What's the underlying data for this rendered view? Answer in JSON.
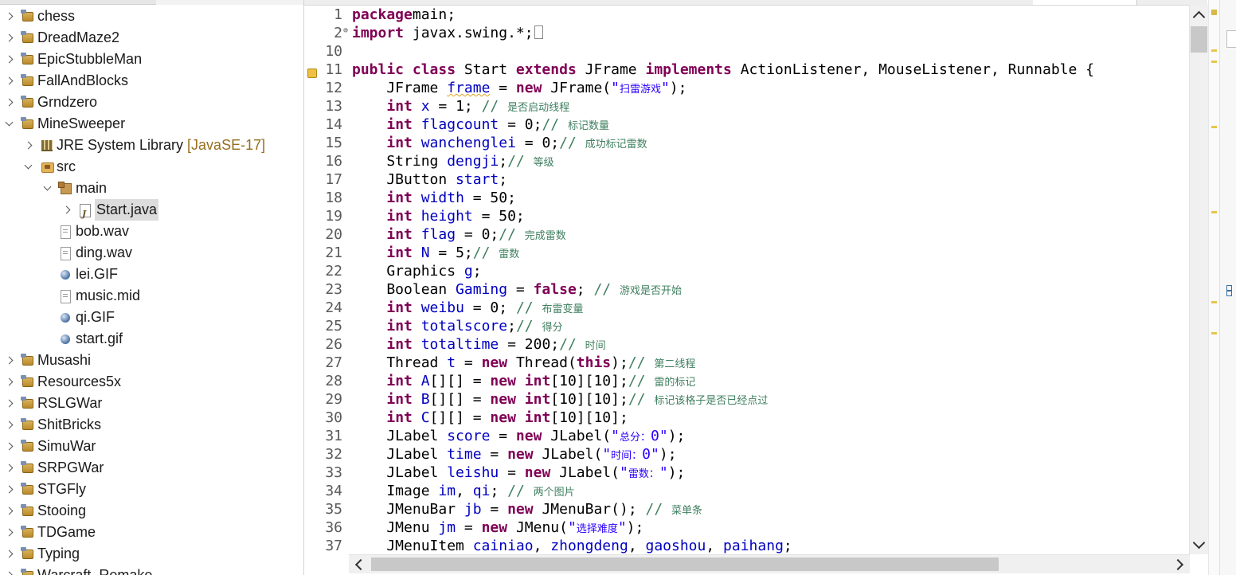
{
  "explorer": {
    "items": [
      {
        "label": "chess",
        "decoration": "",
        "icon": "project-icon",
        "chevron": "right",
        "selected": false
      },
      {
        "label": "DreadMaze2",
        "decoration": "",
        "icon": "project-icon",
        "chevron": "right",
        "selected": false
      },
      {
        "label": "EpicStubbleMan",
        "decoration": "",
        "icon": "project-icon",
        "chevron": "right",
        "selected": false
      },
      {
        "label": "FallAndBlocks",
        "decoration": "",
        "icon": "project-icon",
        "chevron": "right",
        "selected": false
      },
      {
        "label": "Grndzero",
        "decoration": "",
        "icon": "project-icon",
        "chevron": "right",
        "selected": false
      },
      {
        "label": "MineSweeper",
        "decoration": "",
        "icon": "project-icon",
        "chevron": "down",
        "selected": false
      },
      {
        "label": "JRE System Library ",
        "decoration": "[JavaSE-17]",
        "icon": "library-icon",
        "chevron": "right",
        "selected": false
      },
      {
        "label": "src",
        "decoration": "",
        "icon": "source-folder-icon",
        "chevron": "down",
        "selected": false
      },
      {
        "label": "main",
        "decoration": "",
        "icon": "package-icon",
        "chevron": "down",
        "selected": false
      },
      {
        "label": "Start.java",
        "decoration": "",
        "icon": "java-file-icon",
        "chevron": "right",
        "selected": true
      },
      {
        "label": "bob.wav",
        "decoration": "",
        "icon": "file-icon",
        "chevron": "",
        "selected": false
      },
      {
        "label": "ding.wav",
        "decoration": "",
        "icon": "file-icon",
        "chevron": "",
        "selected": false
      },
      {
        "label": "lei.GIF",
        "decoration": "",
        "icon": "image-file-icon",
        "chevron": "",
        "selected": false
      },
      {
        "label": "music.mid",
        "decoration": "",
        "icon": "file-icon",
        "chevron": "",
        "selected": false
      },
      {
        "label": "qi.GIF",
        "decoration": "",
        "icon": "image-file-icon",
        "chevron": "",
        "selected": false
      },
      {
        "label": "start.gif",
        "decoration": "",
        "icon": "image-file-icon",
        "chevron": "",
        "selected": false
      },
      {
        "label": "Musashi",
        "decoration": "",
        "icon": "project-icon",
        "chevron": "right",
        "selected": false
      },
      {
        "label": "Resources5x",
        "decoration": "",
        "icon": "project-icon",
        "chevron": "right",
        "selected": false
      },
      {
        "label": "RSLGWar",
        "decoration": "",
        "icon": "project-icon",
        "chevron": "right",
        "selected": false
      },
      {
        "label": "ShitBricks",
        "decoration": "",
        "icon": "project-icon",
        "chevron": "right",
        "selected": false
      },
      {
        "label": "SimuWar",
        "decoration": "",
        "icon": "project-icon",
        "chevron": "right",
        "selected": false
      },
      {
        "label": "SRPGWar",
        "decoration": "",
        "icon": "project-icon",
        "chevron": "right",
        "selected": false
      },
      {
        "label": "STGFly",
        "decoration": "",
        "icon": "project-icon",
        "chevron": "right",
        "selected": false
      },
      {
        "label": "Stooing",
        "decoration": "",
        "icon": "project-icon",
        "chevron": "right",
        "selected": false
      },
      {
        "label": "TDGame",
        "decoration": "",
        "icon": "project-icon",
        "chevron": "right",
        "selected": false
      },
      {
        "label": "Typing",
        "decoration": "",
        "icon": "project-icon",
        "chevron": "right",
        "selected": false
      },
      {
        "label": "Warcraft_Remake",
        "decoration": "",
        "icon": "project-icon",
        "chevron": "right",
        "selected": false
      }
    ]
  },
  "editor": {
    "lines": [
      {
        "n": "1",
        "fold": "",
        "tokens": [
          [
            "kw",
            "package"
          ],
          [
            "",
            "main;"
          ]
        ]
      },
      {
        "n": "2",
        "fold": "⊕",
        "tokens": [
          [
            "kw",
            "import"
          ],
          [
            "",
            " javax.swing.*;"
          ],
          [
            "box",
            ""
          ]
        ]
      },
      {
        "n": "10",
        "fold": "",
        "tokens": []
      },
      {
        "n": "11",
        "fold": "",
        "warning": true,
        "tokens": [
          [
            "kw",
            "public class "
          ],
          [
            "",
            "Start "
          ],
          [
            "kw",
            "extends "
          ],
          [
            "",
            "JFrame "
          ],
          [
            "kw",
            "implements "
          ],
          [
            "",
            "ActionListener, MouseListener, Runnable {"
          ]
        ]
      },
      {
        "n": "12",
        "fold": "",
        "tokens": [
          [
            "",
            "    JFrame "
          ],
          [
            "fd",
            "frame"
          ],
          [
            "",
            " = "
          ],
          [
            "kw",
            "new "
          ],
          [
            "",
            "JFrame("
          ],
          [
            "st",
            "\"扫雷游戏\""
          ],
          [
            "",
            ");"
          ]
        ]
      },
      {
        "n": "13",
        "fold": "",
        "tokens": [
          [
            "",
            "    "
          ],
          [
            "kw",
            "int "
          ],
          [
            "fd",
            "x"
          ],
          [
            "",
            " = 1; "
          ],
          [
            "cm",
            "// 是否启动线程"
          ]
        ]
      },
      {
        "n": "14",
        "fold": "",
        "tokens": [
          [
            "",
            "    "
          ],
          [
            "kw",
            "int "
          ],
          [
            "fd",
            "flagcount"
          ],
          [
            "",
            " = 0;"
          ],
          [
            "cm",
            "// 标记数量"
          ]
        ]
      },
      {
        "n": "15",
        "fold": "",
        "tokens": [
          [
            "",
            "    "
          ],
          [
            "kw",
            "int "
          ],
          [
            "fd",
            "wanchenglei"
          ],
          [
            "",
            " = 0;"
          ],
          [
            "cm",
            "// 成功标记雷数"
          ]
        ]
      },
      {
        "n": "16",
        "fold": "",
        "tokens": [
          [
            "",
            "    String "
          ],
          [
            "fd",
            "dengji"
          ],
          [
            "",
            ";"
          ],
          [
            "cm",
            "// 等级"
          ]
        ]
      },
      {
        "n": "17",
        "fold": "",
        "tokens": [
          [
            "",
            "    JButton "
          ],
          [
            "fd",
            "start"
          ],
          [
            "",
            ";"
          ]
        ]
      },
      {
        "n": "18",
        "fold": "",
        "tokens": [
          [
            "",
            "    "
          ],
          [
            "kw",
            "int "
          ],
          [
            "fd",
            "width"
          ],
          [
            "",
            " = 50;"
          ]
        ]
      },
      {
        "n": "19",
        "fold": "",
        "tokens": [
          [
            "",
            "    "
          ],
          [
            "kw",
            "int "
          ],
          [
            "fd",
            "height"
          ],
          [
            "",
            " = 50;"
          ]
        ]
      },
      {
        "n": "20",
        "fold": "",
        "tokens": [
          [
            "",
            "    "
          ],
          [
            "kw",
            "int "
          ],
          [
            "fd",
            "flag"
          ],
          [
            "",
            " = 0;"
          ],
          [
            "cm",
            "// 完成雷数"
          ]
        ]
      },
      {
        "n": "21",
        "fold": "",
        "tokens": [
          [
            "",
            "    "
          ],
          [
            "kw",
            "int "
          ],
          [
            "fd",
            "N"
          ],
          [
            "",
            " = 5;"
          ],
          [
            "cm",
            "// 雷数"
          ]
        ]
      },
      {
        "n": "22",
        "fold": "",
        "tokens": [
          [
            "",
            "    Graphics "
          ],
          [
            "fd",
            "g"
          ],
          [
            "",
            ";"
          ]
        ]
      },
      {
        "n": "23",
        "fold": "",
        "tokens": [
          [
            "",
            "    Boolean "
          ],
          [
            "fd",
            "Gaming"
          ],
          [
            "",
            " = "
          ],
          [
            "kw",
            "false"
          ],
          [
            "",
            "; "
          ],
          [
            "cm",
            "// 游戏是否开始"
          ]
        ]
      },
      {
        "n": "24",
        "fold": "",
        "tokens": [
          [
            "",
            "    "
          ],
          [
            "kw",
            "int "
          ],
          [
            "fd",
            "weibu"
          ],
          [
            "",
            " = 0; "
          ],
          [
            "cm",
            "// 布雷变量"
          ]
        ]
      },
      {
        "n": "25",
        "fold": "",
        "tokens": [
          [
            "",
            "    "
          ],
          [
            "kw",
            "int "
          ],
          [
            "fd",
            "totalscore"
          ],
          [
            "",
            ";"
          ],
          [
            "cm",
            "// 得分"
          ]
        ]
      },
      {
        "n": "26",
        "fold": "",
        "tokens": [
          [
            "",
            "    "
          ],
          [
            "kw",
            "int "
          ],
          [
            "fd",
            "totaltime"
          ],
          [
            "",
            " = 200;"
          ],
          [
            "cm",
            "// 时间"
          ]
        ]
      },
      {
        "n": "27",
        "fold": "",
        "tokens": [
          [
            "",
            "    Thread "
          ],
          [
            "fd",
            "t"
          ],
          [
            "",
            " = "
          ],
          [
            "kw",
            "new "
          ],
          [
            "",
            "Thread("
          ],
          [
            "kw",
            "this"
          ],
          [
            "",
            ");"
          ],
          [
            "cm",
            "// 第二线程"
          ]
        ]
      },
      {
        "n": "28",
        "fold": "",
        "tokens": [
          [
            "",
            "    "
          ],
          [
            "kw",
            "int "
          ],
          [
            "fd",
            "A"
          ],
          [
            "",
            "[][] = "
          ],
          [
            "kw",
            "new int"
          ],
          [
            "",
            "[10][10];"
          ],
          [
            "cm",
            "// 雷的标记"
          ]
        ]
      },
      {
        "n": "29",
        "fold": "",
        "tokens": [
          [
            "",
            "    "
          ],
          [
            "kw",
            "int "
          ],
          [
            "fd",
            "B"
          ],
          [
            "",
            "[][] = "
          ],
          [
            "kw",
            "new int"
          ],
          [
            "",
            "[10][10];"
          ],
          [
            "cm",
            "// 标记该格子是否已经点过"
          ]
        ]
      },
      {
        "n": "30",
        "fold": "",
        "tokens": [
          [
            "",
            "    "
          ],
          [
            "kw",
            "int "
          ],
          [
            "fd",
            "C"
          ],
          [
            "",
            "[][] = "
          ],
          [
            "kw",
            "new int"
          ],
          [
            "",
            "[10][10];"
          ]
        ]
      },
      {
        "n": "31",
        "fold": "",
        "tokens": [
          [
            "",
            "    JLabel "
          ],
          [
            "fd",
            "score"
          ],
          [
            "",
            " = "
          ],
          [
            "kw",
            "new "
          ],
          [
            "",
            "JLabel("
          ],
          [
            "st",
            "\"总分：0\""
          ],
          [
            "",
            ");"
          ]
        ]
      },
      {
        "n": "32",
        "fold": "",
        "tokens": [
          [
            "",
            "    JLabel "
          ],
          [
            "fd",
            "time"
          ],
          [
            "",
            " = "
          ],
          [
            "kw",
            "new "
          ],
          [
            "",
            "JLabel("
          ],
          [
            "st",
            "\"时间：0\""
          ],
          [
            "",
            ");"
          ]
        ]
      },
      {
        "n": "33",
        "fold": "",
        "tokens": [
          [
            "",
            "    JLabel "
          ],
          [
            "fd",
            "leishu"
          ],
          [
            "",
            " = "
          ],
          [
            "kw",
            "new "
          ],
          [
            "",
            "JLabel("
          ],
          [
            "st",
            "\"雷数：\""
          ],
          [
            "",
            ");"
          ]
        ]
      },
      {
        "n": "34",
        "fold": "",
        "tokens": [
          [
            "",
            "    Image "
          ],
          [
            "fd",
            "im"
          ],
          [
            "",
            ", "
          ],
          [
            "fd",
            "qi"
          ],
          [
            "",
            "; "
          ],
          [
            "cm",
            "// 两个图片"
          ]
        ]
      },
      {
        "n": "35",
        "fold": "",
        "tokens": [
          [
            "",
            "    JMenuBar "
          ],
          [
            "fd",
            "jb"
          ],
          [
            "",
            " = "
          ],
          [
            "kw",
            "new "
          ],
          [
            "",
            "JMenuBar(); "
          ],
          [
            "cm",
            "// 菜单条"
          ]
        ]
      },
      {
        "n": "36",
        "fold": "",
        "tokens": [
          [
            "",
            "    JMenu "
          ],
          [
            "fd",
            "jm"
          ],
          [
            "",
            " = "
          ],
          [
            "kw",
            "new "
          ],
          [
            "",
            "JMenu("
          ],
          [
            "st",
            "\"选择难度\""
          ],
          [
            "",
            ");"
          ]
        ]
      },
      {
        "n": "37",
        "fold": "",
        "tokens": [
          [
            "",
            "    JMenuItem "
          ],
          [
            "fd",
            "cainiao"
          ],
          [
            "",
            ", "
          ],
          [
            "fd",
            "zhongdeng"
          ],
          [
            "",
            ", "
          ],
          [
            "fd",
            "gaoshou"
          ],
          [
            "",
            ", "
          ],
          [
            "fd",
            "paihang"
          ],
          [
            "",
            ";"
          ]
        ]
      }
    ]
  },
  "colors": {
    "keyword": "#7f0055",
    "field": "#0000c0",
    "string": "#2a00ff",
    "comment": "#3f7f5f",
    "selection": "#dcdcdc"
  }
}
